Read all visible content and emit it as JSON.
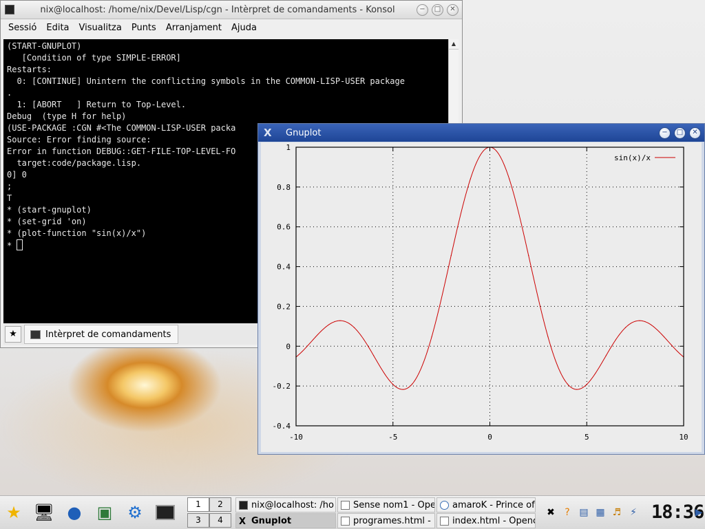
{
  "konsole": {
    "title": "nix@localhost: /home/nix/Devel/Lisp/cgn - Intèrpret de comandaments - Konsol",
    "menu": [
      "Sessió",
      "Edita",
      "Visualitza",
      "Punts",
      "Arranjament",
      "Ajuda"
    ],
    "terminal_lines": [
      "(START-GNUPLOT)",
      "   [Condition of type SIMPLE-ERROR]",
      "",
      "Restarts:",
      "  0: [CONTINUE] Unintern the conflicting symbols in the COMMON-LISP-USER package",
      ".",
      "  1: [ABORT   ] Return to Top-Level.",
      "",
      "Debug  (type H for help)",
      "",
      "(USE-PACKAGE :CGN #<The COMMON-LISP-USER packa",
      "Source: Error finding source:",
      "Error in function DEBUG::GET-FILE-TOP-LEVEL-FO",
      "  target:code/package.lisp.",
      "0] 0",
      ";",
      "T",
      "* (start-gnuplot)",
      "",
      "* (set-grid 'on)",
      "",
      "* (plot-function \"sin(x)/x\")",
      "",
      "* "
    ],
    "tab_label": "Intèrpret de comandaments"
  },
  "gnuplot": {
    "title": "Gnuplot"
  },
  "chart_data": {
    "type": "line",
    "title": "",
    "xlabel": "",
    "ylabel": "",
    "xlim": [
      -10,
      10
    ],
    "ylim": [
      -0.4,
      1
    ],
    "xticks": [
      "-10",
      "-5",
      "0",
      "5",
      "10"
    ],
    "yticks": [
      "-0.4",
      "-0.2",
      "0",
      "0.2",
      "0.4",
      "0.6",
      "0.8",
      "1"
    ],
    "grid": true,
    "legend": "top-right",
    "series": [
      {
        "name": "sin(x)/x",
        "color": "#cc0000",
        "x": [
          -10,
          -9,
          -8,
          -7.73,
          -7,
          -6,
          -5,
          -4.49,
          -4,
          -3,
          -2,
          -1,
          0,
          1,
          2,
          3,
          4,
          4.49,
          5,
          6,
          7,
          7.73,
          8,
          9,
          10
        ],
        "y": [
          -0.054,
          0.046,
          0.124,
          0.128,
          0.094,
          -0.047,
          -0.192,
          -0.217,
          -0.189,
          0.047,
          0.455,
          0.841,
          1.0,
          0.841,
          0.455,
          0.047,
          -0.189,
          -0.217,
          -0.192,
          -0.047,
          0.094,
          0.128,
          0.124,
          0.046,
          -0.054
        ]
      }
    ]
  },
  "taskbar": {
    "pager": [
      "1",
      "2",
      "3",
      "4"
    ],
    "tasks": [
      {
        "label": "nix@localhost: /ho",
        "active": false
      },
      {
        "label": "Gnuplot",
        "active": true
      },
      {
        "label": "Sense nom1 - Ope",
        "active": false
      },
      {
        "label": "programes.html - ",
        "active": false
      },
      {
        "label": "amaroK - Prince of",
        "active": false
      },
      {
        "label": "index.html - Openc",
        "active": false
      }
    ],
    "clock": "18:36"
  }
}
